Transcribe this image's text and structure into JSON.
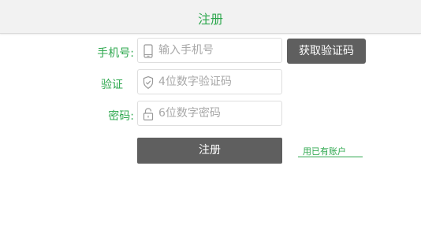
{
  "header": {
    "title": "注册"
  },
  "form": {
    "phone": {
      "label": "手机号:",
      "placeholder": "输入手机号",
      "icon": "phone-icon"
    },
    "code": {
      "label": "验证",
      "placeholder": "4位数字验证码",
      "icon": "shield-check-icon"
    },
    "password": {
      "label": "密码:",
      "placeholder": "6位数字密码",
      "icon": "lock-icon"
    },
    "get_code_label": "获取验证码",
    "submit_label": "注册",
    "login_link": "用已有账户"
  },
  "colors": {
    "accent": "#2fa84f",
    "button_bg": "#5f5f5f",
    "header_bg": "#f2f2f2"
  }
}
